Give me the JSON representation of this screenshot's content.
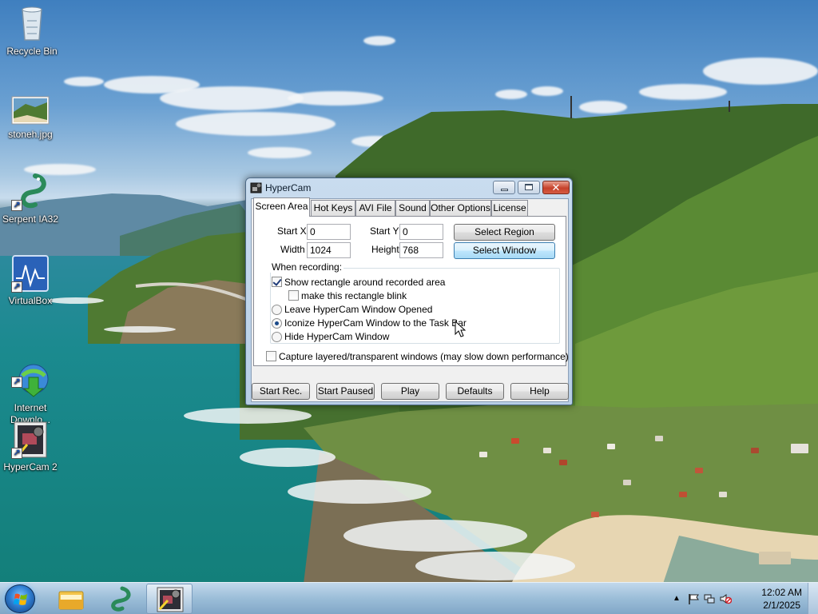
{
  "desktop": {
    "icons": [
      {
        "label": "Recycle Bin",
        "icon": "recycle-bin-icon"
      },
      {
        "label": "stoneh.jpg",
        "icon": "image-file-icon"
      },
      {
        "label": "Serpent IA32",
        "icon": "serpent-dragon-icon"
      },
      {
        "label": "VirtualBox",
        "icon": "virtualbox-icon"
      },
      {
        "label": "Internet\nDownlo...",
        "icon": "internet-download-manager-icon"
      },
      {
        "label": "HyperCam 2",
        "icon": "hypercam-icon"
      }
    ]
  },
  "window": {
    "title": "HyperCam",
    "tabs": [
      "Screen Area",
      "Hot Keys",
      "AVI File",
      "Sound",
      "Other Options",
      "License"
    ],
    "active_tab": "Screen Area",
    "screen_area": {
      "start_x_label": "Start X",
      "start_x": "0",
      "start_y_label": "Start Y",
      "start_y": "0",
      "width_label": "Width",
      "width": "1024",
      "height_label": "Height",
      "height": "768",
      "select_region": "Select Region",
      "select_window": "Select Window",
      "when_recording": "When recording:",
      "show_rectangle": "Show rectangle around recorded area",
      "show_rectangle_checked": true,
      "blink": "make this rectangle blink",
      "blink_checked": false,
      "radio_options": [
        "Leave HyperCam Window Opened",
        "Iconize HyperCam Window to the Task Bar",
        "Hide HyperCam Window"
      ],
      "radio_selected": 1,
      "capture_layered": "Capture layered/transparent windows (may slow down performance)",
      "capture_layered_checked": false
    },
    "buttons": {
      "start_rec": "Start Rec.",
      "start_paused": "Start Paused",
      "play": "Play",
      "defaults": "Defaults",
      "help": "Help"
    }
  },
  "taskbar": {
    "pinned": [
      "windows-explorer-icon",
      "serpent-dragon-icon",
      "hypercam-icon"
    ],
    "active_item": "hypercam-icon",
    "tray_icons": [
      "show-hidden-icons-chevron",
      "action-center-flag-icon",
      "network-icon",
      "volume-muted-icon"
    ],
    "time": "12:02 AM",
    "date": "2/1/2025"
  },
  "colors": {
    "title_text": "#0b1a2a",
    "close_button": "#c6422b",
    "focused_button": "#a7d9f5"
  }
}
